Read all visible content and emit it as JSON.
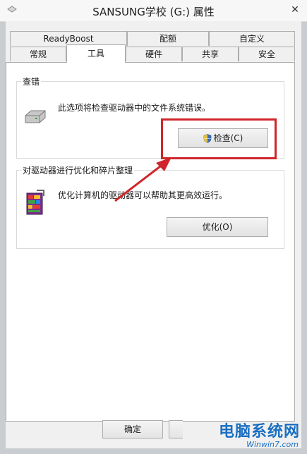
{
  "window": {
    "title": "SANSUNG学校 (G:) 属性",
    "close_glyph": "✕"
  },
  "tabs": {
    "row1": [
      {
        "label": "ReadyBoost"
      },
      {
        "label": "配额"
      },
      {
        "label": "自定义"
      }
    ],
    "row2": [
      {
        "label": "常规"
      },
      {
        "label": "工具",
        "active": true
      },
      {
        "label": "硬件"
      },
      {
        "label": "共享"
      },
      {
        "label": "安全"
      }
    ]
  },
  "error_check": {
    "title": "查错",
    "description": "此选项将检查驱动器中的文件系统错误。",
    "button_label": "检查(C)",
    "icon": "drive-icon"
  },
  "optimize": {
    "title": "对驱动器进行优化和碎片整理",
    "description": "优化计算机的驱动器可以帮助其更高效运行。",
    "button_label": "优化(O)",
    "icon": "defrag-icon"
  },
  "footer": {
    "ok_label": "确定"
  },
  "watermark": {
    "big": "电脑系统网",
    "small": "Winwin7.com"
  },
  "colors": {
    "highlight": "#d0262b",
    "arrow": "#d0262b",
    "watermark": "#1b6fc2"
  }
}
